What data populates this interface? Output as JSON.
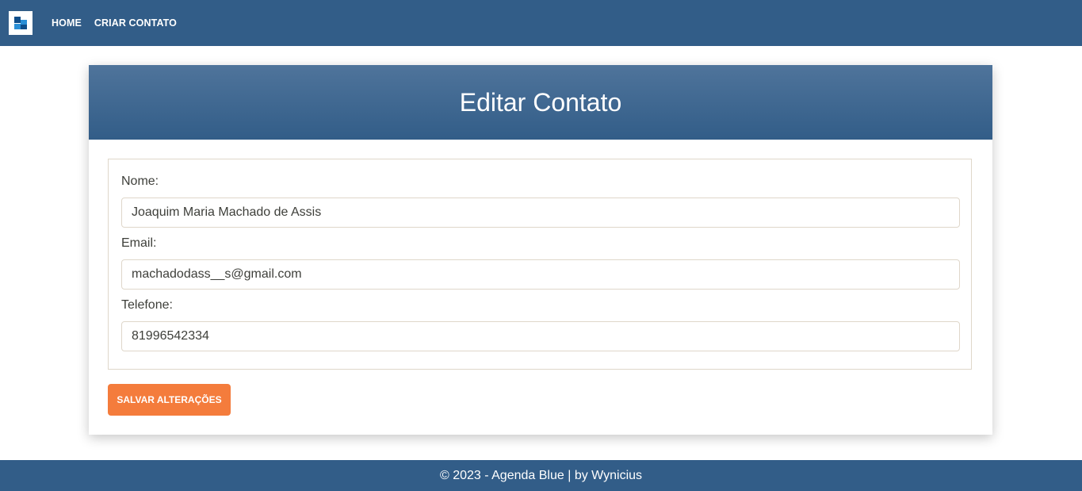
{
  "navbar": {
    "logo_icon": "app-logo-icon",
    "links": {
      "home": "HOME",
      "create_contact": "CRIAR CONTATO"
    }
  },
  "card": {
    "title": "Editar Contato"
  },
  "form": {
    "name": {
      "label": "Nome:",
      "value": "Joaquim Maria Machado de Assis"
    },
    "email": {
      "label": "Email:",
      "value": "machadodass__s@gmail.com"
    },
    "phone": {
      "label": "Telefone:",
      "value": "81996542334"
    },
    "save_label": "SALVAR ALTERAÇÕES"
  },
  "footer": {
    "text": "© 2023 - Agenda Blue | by Wynicius"
  },
  "colors": {
    "primary": "#325d88",
    "accent": "#f47c3c",
    "border": "#dfd7ca",
    "text": "#3e3f3a"
  }
}
